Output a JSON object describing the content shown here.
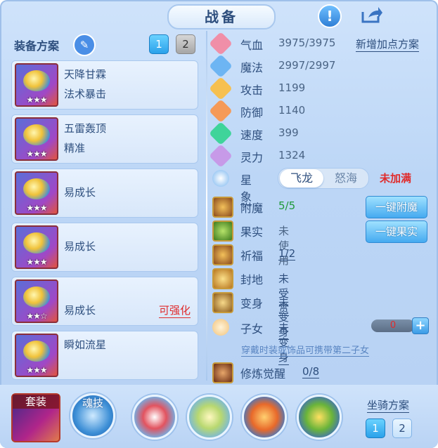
{
  "header": {
    "title": "战备"
  },
  "plan": {
    "label": "装备方案",
    "tabs": [
      "1",
      "2"
    ]
  },
  "equipment": [
    {
      "name": "天降甘霖",
      "effect": "法术暴击",
      "stars": "★★★"
    },
    {
      "name": "五雷轰顶",
      "effect": "精准",
      "stars": "★★★"
    },
    {
      "name": "",
      "effect": "易成长",
      "stars": "★★★"
    },
    {
      "name": "",
      "effect": "易成长",
      "stars": "★★★"
    },
    {
      "name": "",
      "effect": "易成长",
      "stars": "★★☆",
      "enhance": "可强化"
    },
    {
      "name": "瞬如流星",
      "effect": "",
      "stars": "★★★"
    }
  ],
  "stats": [
    {
      "name": "气血",
      "value": "3975/3975"
    },
    {
      "name": "魔法",
      "value": "2997/2997"
    },
    {
      "name": "攻击",
      "value": "1199"
    },
    {
      "name": "防御",
      "value": "1140"
    },
    {
      "name": "速度",
      "value": "399"
    },
    {
      "name": "灵力",
      "value": "1324"
    }
  ],
  "add_plan_label": "新增加点方案",
  "star_sign": {
    "label": "星象",
    "options": [
      "飞龙",
      "怒海"
    ],
    "status": "未加满"
  },
  "features": {
    "enchant": {
      "label": "附魔",
      "value": "5/5",
      "button": "一键附魔"
    },
    "fruit": {
      "label": "果实",
      "value": "未使用",
      "button": "一键果实"
    },
    "blessing": {
      "label": "祈福",
      "value": "1/2"
    },
    "fief": {
      "label": "封地",
      "value": "未受赏"
    },
    "transform": {
      "label": "变身",
      "value": "未变身"
    },
    "child": {
      "label": "子女",
      "value": "未变身",
      "count": "0",
      "note": "穿戴时装或饰品可携带第二子女"
    },
    "cultivation": {
      "label": "修炼觉醒",
      "value": "0/8"
    }
  },
  "bottom": {
    "set_label": "套装",
    "soul_label": "魂技",
    "mount_label": "坐骑方案",
    "mount_tabs": [
      "1",
      "2"
    ]
  },
  "colors": {
    "accent": "#2aa1ea",
    "warning": "#e02b2b",
    "good": "#1f9a3a",
    "text": "#2e4f7e"
  }
}
